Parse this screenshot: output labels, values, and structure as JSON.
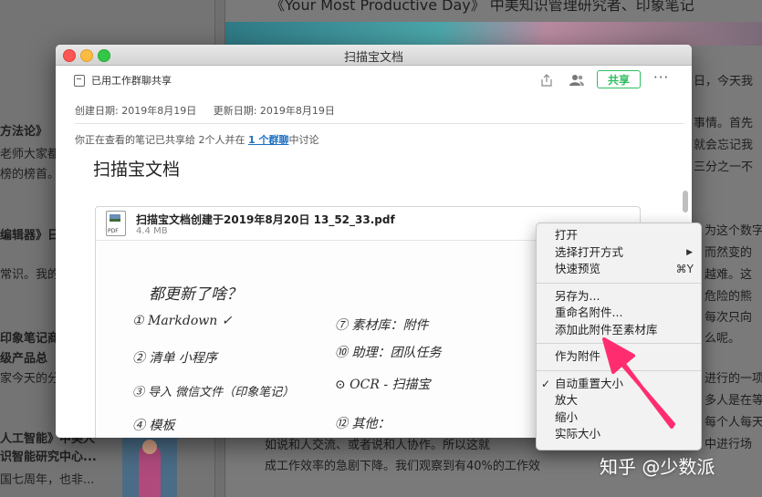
{
  "background": {
    "top_title": "《Your Most Productive Day》 中美知识管理研究者、印象笔记",
    "left_column": [
      "方法论》",
      "老师大家都",
      "榜的榜首。",
      "编辑器》日",
      "常识。我的",
      "印象笔记商",
      "级产品总",
      "家今天的分",
      "人工智能》中美人",
      "识智能研究中心...",
      "国七周年，也非..."
    ],
    "right_column": [
      "日，今天我",
      "事情。首先",
      "就会忘记我",
      "三分之一不",
      "为这个数字",
      "而然变的",
      "越难。这",
      "危险的熊",
      "每次只向",
      "么呢。",
      "进行的一项",
      "多人是在等",
      "每个人每天",
      "中进行场",
      "如说和人交流、或者说和人协作。所以这就",
      "成工作效率的急剧下降。我们观察到有40%的工作效"
    ]
  },
  "window": {
    "title": "扫描宝文档",
    "toolbar": {
      "share_info": "已用工作群聊共享",
      "share_button": "共享",
      "more": "···",
      "icons": [
        "export-icon",
        "people-icon"
      ]
    },
    "meta": {
      "created": "创建日期: 2019年8月19日",
      "updated": "更新日期: 2019年8月19日"
    },
    "notice": {
      "prefix": "你正在查看的笔记已共享给 2个人并在 ",
      "link": "1 个群聊",
      "suffix": "中讨论"
    },
    "note_title": "扫描宝文档",
    "attachment": {
      "file_name": "扫描宝文档创建于2019年8月20日 13_52_33.pdf",
      "file_size": "4.4 MB",
      "file_type": "PDF",
      "handwriting": {
        "heading": "都更新了啥？",
        "left": [
          "① Markdown ✓",
          "② 清单 小程序",
          "③ 导入 微信文件（印象笔记）",
          "④ 模板"
        ],
        "right": [
          "⑦ 素材库：附件",
          "⑩ 助理：团队任务",
          "⊙ OCR - 扫描宝",
          "⑫ 其他："
        ]
      }
    }
  },
  "context_menu": {
    "groups": [
      [
        {
          "label": "打开"
        },
        {
          "label": "选择打开方式",
          "submenu": true
        },
        {
          "label": "快速预览",
          "shortcut": "⌘Y"
        }
      ],
      [
        {
          "label": "另存为..."
        },
        {
          "label": "重命名附件..."
        },
        {
          "label": "添加此附件至素材库"
        }
      ],
      [
        {
          "label": "作为附件"
        }
      ],
      [
        {
          "label": "自动重置大小",
          "checked": true
        },
        {
          "label": "放大"
        },
        {
          "label": "缩小"
        },
        {
          "label": "实际大小"
        }
      ]
    ]
  },
  "watermark": "知乎 @少数派",
  "colors": {
    "accent_green": "#2dbe60",
    "link_blue": "#1a6fc1",
    "annotation_pink": "#ff2d6f"
  }
}
